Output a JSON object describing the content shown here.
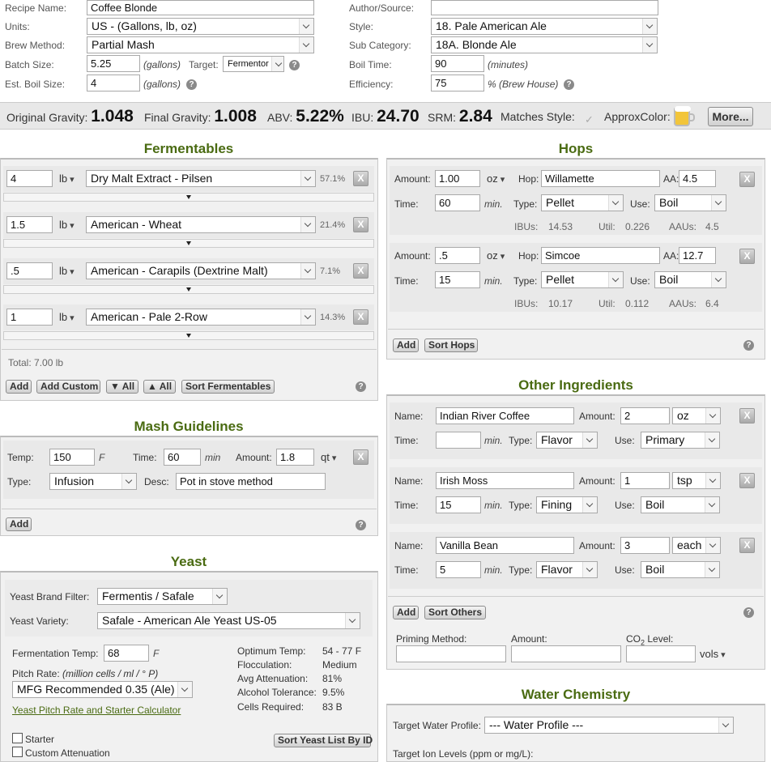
{
  "recipe": {
    "name_label": "Recipe Name:",
    "name": "Coffee Blonde",
    "author_label": "Author/Source:",
    "author": "",
    "units_label": "Units:",
    "units": "US - (Gallons, lb, oz)",
    "style_label": "Style:",
    "style": "18. Pale American Ale",
    "method_label": "Brew Method:",
    "method": "Partial Mash",
    "subcat_label": "Sub Category:",
    "subcat": "18A. Blonde Ale",
    "batch_label": "Batch Size:",
    "batch": "5.25",
    "batch_unit": "(gallons)",
    "target_label": "Target:",
    "target": "Fermentor",
    "boiltime_label": "Boil Time:",
    "boiltime": "90",
    "boiltime_unit": "(minutes)",
    "boilsize_label": "Est. Boil Size:",
    "boilsize": "4",
    "boilsize_unit": "(gallons)",
    "eff_label": "Efficiency:",
    "eff": "75",
    "eff_unit": "% (Brew House)"
  },
  "stats": {
    "og_label": "Original Gravity:",
    "og": "1.048",
    "fg_label": "Final Gravity:",
    "fg": "1.008",
    "abv_label": "ABV:",
    "abv": "5.22%",
    "ibu_label": "IBU:",
    "ibu": "24.70",
    "srm_label": "SRM:",
    "srm": "2.84",
    "match_label": "Matches Style:",
    "color_label": "ApproxColor:",
    "more": "More...",
    "beer_color": "#f2c53a"
  },
  "fermentables": {
    "title": "Fermentables",
    "total": "Total: 7.00 lb",
    "items": [
      {
        "amount": "4",
        "unit": "lb",
        "name": "Dry Malt Extract - Pilsen",
        "pct": "57.1%"
      },
      {
        "amount": "1.5",
        "unit": "lb",
        "name": "American - Wheat",
        "pct": "21.4%"
      },
      {
        "amount": ".5",
        "unit": "lb",
        "name": "American - Carapils (Dextrine Malt)",
        "pct": "7.1%"
      },
      {
        "amount": "1",
        "unit": "lb",
        "name": "American - Pale 2-Row",
        "pct": "14.3%"
      }
    ],
    "buttons": {
      "add": "Add",
      "add_custom": "Add Custom",
      "collapse_all": "▼ All",
      "expand_all": "▲ All",
      "sort": "Sort Fermentables"
    }
  },
  "hops": {
    "title": "Hops",
    "amount_label": "Amount:",
    "hop_label": "Hop:",
    "aa_label": "AA:",
    "time_label": "Time:",
    "min": "min.",
    "type_label": "Type:",
    "use_label": "Use:",
    "ibus_label": "IBUs:",
    "util_label": "Util:",
    "aaus_label": "AAUs:",
    "items": [
      {
        "amount": "1.00",
        "unit": "oz",
        "name": "Willamette",
        "aa": "4.5",
        "time": "60",
        "type": "Pellet",
        "use": "Boil",
        "ibus": "14.53",
        "util": "0.226",
        "aaus": "4.5"
      },
      {
        "amount": ".5",
        "unit": "oz",
        "name": "Simcoe",
        "aa": "12.7",
        "time": "15",
        "type": "Pellet",
        "use": "Boil",
        "ibus": "10.17",
        "util": "0.112",
        "aaus": "6.4"
      }
    ],
    "buttons": {
      "add": "Add",
      "sort": "Sort Hops"
    }
  },
  "mash": {
    "title": "Mash Guidelines",
    "temp_label": "Temp:",
    "temp": "150",
    "temp_unit": "F",
    "time_label": "Time:",
    "time": "60",
    "time_unit": "min",
    "amount_label": "Amount:",
    "amount": "1.8",
    "amount_unit": "qt",
    "type_label": "Type:",
    "type": "Infusion",
    "desc_label": "Desc:",
    "desc": "Pot in stove method",
    "add": "Add"
  },
  "other": {
    "title": "Other Ingredients",
    "name_label": "Name:",
    "amount_label": "Amount:",
    "time_label": "Time:",
    "min": "min.",
    "type_label": "Type:",
    "use_label": "Use:",
    "items": [
      {
        "name": "Indian River Coffee",
        "amount": "2",
        "unit": "oz",
        "time": "",
        "type": "Flavor",
        "use": "Primary"
      },
      {
        "name": "Irish Moss",
        "amount": "1",
        "unit": "tsp",
        "time": "15",
        "type": "Fining",
        "use": "Boil"
      },
      {
        "name": "Vanilla Bean",
        "amount": "3",
        "unit": "each",
        "time": "5",
        "type": "Flavor",
        "use": "Boil"
      }
    ],
    "buttons": {
      "add": "Add",
      "sort": "Sort Others"
    },
    "priming_label": "Priming Method:",
    "priming_amount_label": "Amount:",
    "co2_label": "CO",
    "co2_sub": "2",
    "co2_label2": " Level:",
    "vols": "vols"
  },
  "yeast": {
    "title": "Yeast",
    "brand_label": "Yeast Brand Filter:",
    "brand": "Fermentis / Safale",
    "variety_label": "Yeast Variety:",
    "variety": "Safale - American Ale Yeast US-05",
    "ferm_temp_label": "Fermentation Temp:",
    "ferm_temp": "68",
    "ferm_temp_unit": "F",
    "pitch_label": "Pitch Rate:",
    "pitch_unit": "(million cells / ml / ° P)",
    "pitch": "MFG Recommended 0.35 (Ale)",
    "calc_link": "Yeast Pitch Rate and Starter Calculator",
    "opt_temp_label": "Optimum Temp:",
    "opt_temp": "54 - 77 F",
    "floc_label": "Flocculation:",
    "floc": "Medium",
    "atten_label": "Avg Attenuation:",
    "atten": "81%",
    "alc_label": "Alcohol Tolerance:",
    "alc": "9.5%",
    "cells_label": "Cells Required:",
    "cells": "83 B",
    "starter": "Starter",
    "custom_atten": "Custom Attenuation",
    "sort": "Sort Yeast List By ID"
  },
  "water": {
    "title": "Water Chemistry",
    "profile_label": "Target Water Profile:",
    "profile": "--- Water Profile ---",
    "ion_label": "Target Ion Levels (ppm or mg/L):"
  }
}
